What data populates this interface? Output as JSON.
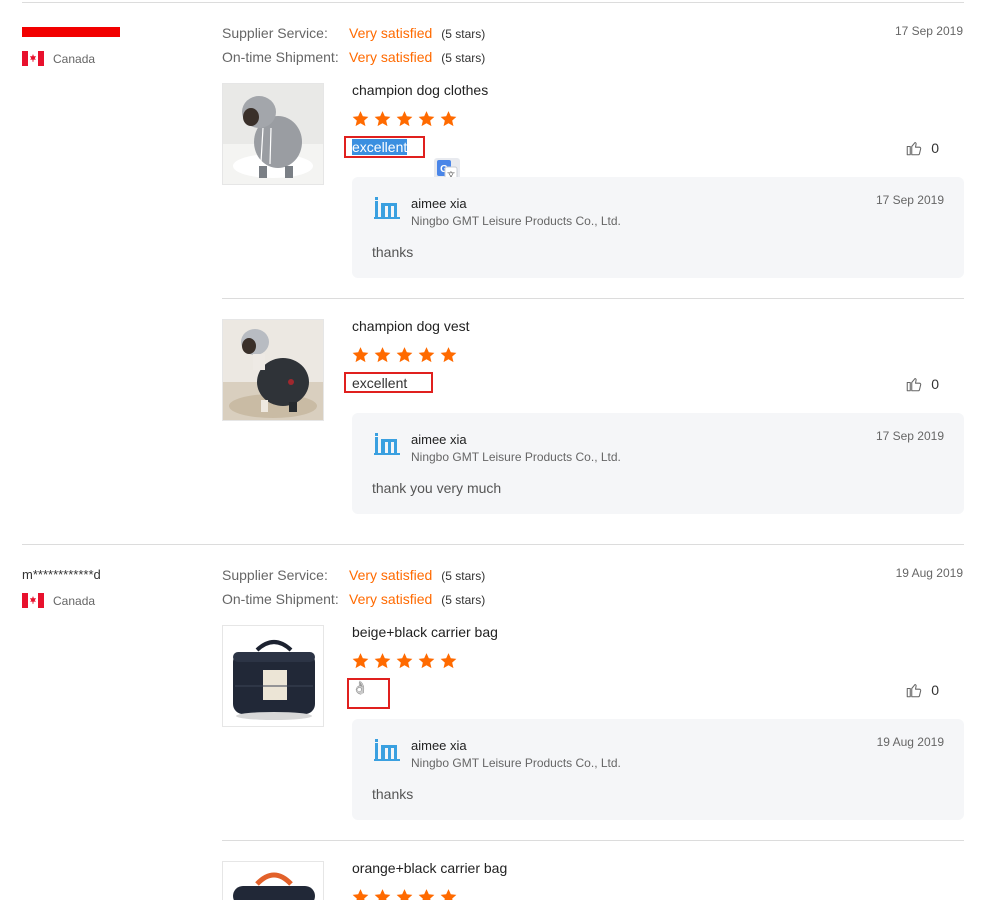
{
  "colors": {
    "accent": "#ff6a00",
    "highlight_box": "#e0201e",
    "selection": "#3b8fe0"
  },
  "reviews": [
    {
      "buyer": {
        "name": "",
        "name_masked": true,
        "country": "Canada"
      },
      "ratings": [
        {
          "label": "Supplier Service:",
          "value": "Very satisfied",
          "stars": "(5 stars)"
        },
        {
          "label": "On-time Shipment:",
          "value": "Very satisfied",
          "stars": "(5 stars)"
        }
      ],
      "date": "17 Sep 2019",
      "items": [
        {
          "product": "champion dog clothes",
          "stars": 5,
          "text": "excellent",
          "likes": "0",
          "reply": {
            "seller": "aimee xia",
            "company": "Ningbo GMT Leisure Products Co., Ltd.",
            "date": "17 Sep 2019",
            "text": "thanks"
          }
        },
        {
          "product": "champion dog vest",
          "stars": 5,
          "text": "excellent",
          "likes": "0",
          "reply": {
            "seller": "aimee xia",
            "company": "Ningbo GMT Leisure Products Co., Ltd.",
            "date": "17 Sep 2019",
            "text": "thank you very much"
          }
        }
      ]
    },
    {
      "buyer": {
        "name": "m************d",
        "country": "Canada"
      },
      "ratings": [
        {
          "label": "Supplier Service:",
          "value": "Very satisfied",
          "stars": "(5 stars)"
        },
        {
          "label": "On-time Shipment:",
          "value": "Very satisfied",
          "stars": "(5 stars)"
        }
      ],
      "date": "19 Aug 2019",
      "items": [
        {
          "product": "beige+black carrier bag",
          "stars": 5,
          "text": "👌",
          "likes": "0",
          "reply": {
            "seller": "aimee xia",
            "company": "Ningbo GMT Leisure Products Co., Ltd.",
            "date": "19 Aug 2019",
            "text": "thanks"
          }
        },
        {
          "product": "orange+black carrier bag",
          "stars": 5
        }
      ]
    }
  ],
  "icons": {
    "flag": "canada-flag-icon",
    "like": "thumbs-up-icon",
    "translate": "google-translate-icon",
    "seller_logo": "gmt-logo-icon"
  }
}
